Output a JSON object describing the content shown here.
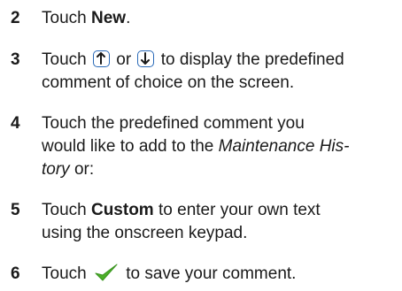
{
  "steps": [
    {
      "num": "2",
      "t1": "Touch ",
      "b1": "New",
      "t2": "."
    },
    {
      "num": "3",
      "t1": "Touch ",
      "t2": " or ",
      "t3": " to display the predefined",
      "line2": "comment of choice on the screen."
    },
    {
      "num": "4",
      "line1": "Touch the predefined comment you",
      "line2a": "would like to add to the ",
      "italic1": "Maintenance His-",
      "italic2": "tory",
      "line3b": " or:"
    },
    {
      "num": "5",
      "t1": "Touch ",
      "b1": "Custom",
      "t2": " to enter your own text",
      "line2": "using the onscreen keypad."
    },
    {
      "num": "6",
      "t1": "Touch ",
      "t2": " to save your comment."
    }
  ],
  "colors": {
    "arrow_button": "#2a6ab8",
    "check": "#4caf28"
  },
  "icons": [
    "arrow-up-icon",
    "arrow-down-icon",
    "checkmark-icon"
  ]
}
